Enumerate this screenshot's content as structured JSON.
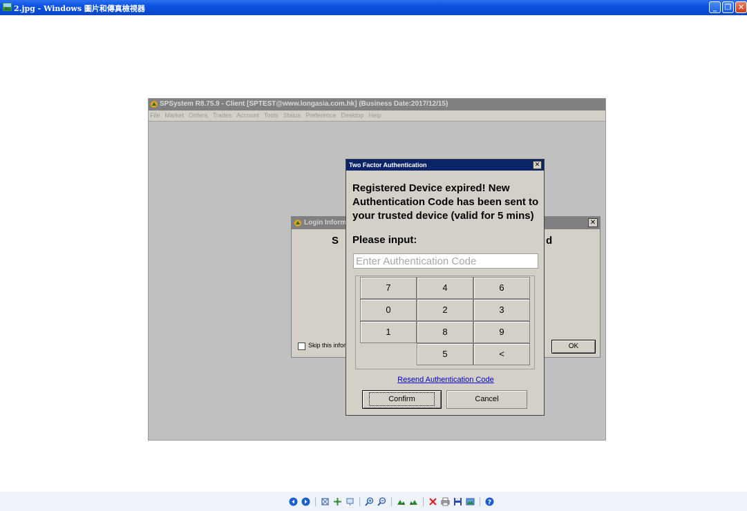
{
  "viewer": {
    "title": "2.jpg - Windows 圖片和傳真檢視器",
    "min_glyph": "_",
    "restore_glyph": "❐",
    "close_glyph": "✕"
  },
  "sp_window": {
    "title": "SPSystem R8.75.9 - Client [SPTEST@www.longasia.com.hk] (Business Date:2017/12/15)",
    "menu": [
      "File",
      "Market",
      "Orders",
      "Trades",
      "Account",
      "Tools",
      "Status",
      "Preference",
      "Desktop",
      "Help"
    ]
  },
  "login_dialog": {
    "title": "Login Inform",
    "close_glyph": "✕",
    "heading_left": "S",
    "heading_right": "d",
    "skip_label": "Skip this inforr",
    "ok_label": "OK"
  },
  "tfa_dialog": {
    "title": "Two Factor Authentication",
    "close_glyph": "✕",
    "message": "Registered Device expired! New Authentication Code has been sent to your trusted device (valid for 5 mins)",
    "prompt": "Please input:",
    "input_placeholder": "Enter Authentication Code",
    "input_value": "",
    "keys": [
      [
        "7",
        "4",
        "6"
      ],
      [
        "0",
        "2",
        "3"
      ],
      [
        "1",
        "8",
        "9"
      ],
      [
        "",
        "5",
        "<"
      ]
    ],
    "resend_label": "Resend Authentication Code",
    "confirm_label": "Confirm",
    "cancel_label": "Cancel"
  },
  "toolbar_icons": [
    "previous-image-icon",
    "next-image-icon",
    "best-fit-icon",
    "actual-size-icon",
    "slideshow-icon",
    "zoom-in-icon",
    "zoom-out-icon",
    "rotate-clockwise-icon",
    "rotate-counterclockwise-icon",
    "delete-icon",
    "print-icon",
    "save-icon",
    "open-editor-icon",
    "help-icon"
  ],
  "colors": {
    "xp_titlebar": "#0a53e0",
    "dialog_active_titlebar": "#0a246a",
    "dialog_face": "#d4d0c8",
    "link": "#0000cc"
  }
}
